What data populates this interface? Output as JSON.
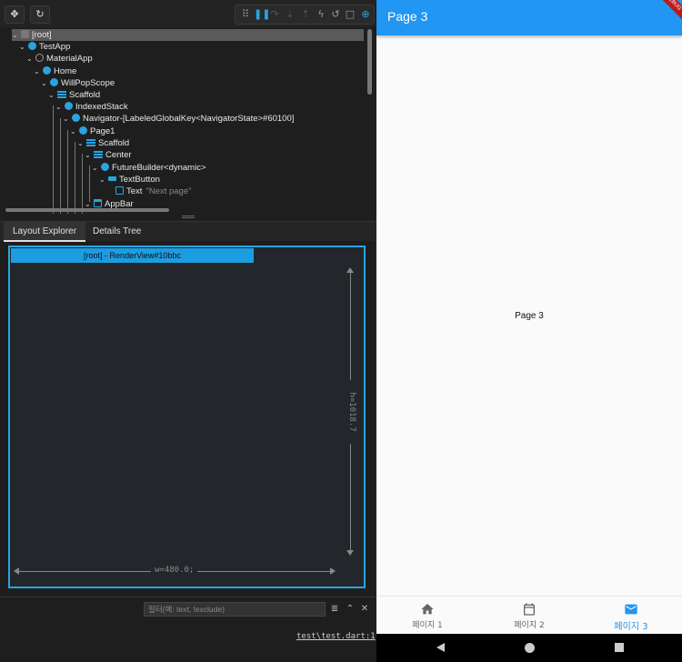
{
  "devtools": {
    "toolbar": {
      "select_widget_icon": "select-widget-icon",
      "refresh_icon": "refresh-icon",
      "group_icons": [
        "drag-handle-icon",
        "pause-icon",
        "redo-icon",
        "step-down-icon",
        "step-up-icon",
        "lightning-icon",
        "undo-icon",
        "square-icon",
        "zoom-icon"
      ]
    },
    "tree": {
      "nodes": [
        {
          "label": "[root]",
          "selected": true
        },
        {
          "label": "TestApp"
        },
        {
          "label": "MaterialApp"
        },
        {
          "label": "Home"
        },
        {
          "label": "WillPopScope"
        },
        {
          "label": "Scaffold"
        },
        {
          "label": "IndexedStack"
        },
        {
          "label": "Navigator-[LabeledGlobalKey<NavigatorState>#60100]"
        },
        {
          "label": "Page1"
        },
        {
          "label": "Scaffold"
        },
        {
          "label": "Center"
        },
        {
          "label": "FutureBuilder<dynamic>"
        },
        {
          "label": "TextButton"
        },
        {
          "label": "Text",
          "value": "\"Next page\""
        },
        {
          "label": "AppBar"
        }
      ]
    },
    "tabs": [
      {
        "label": "Layout Explorer",
        "active": true
      },
      {
        "label": "Details Tree",
        "active": false
      }
    ],
    "layout_explorer": {
      "node_label": "[root] - RenderView#10bbc",
      "height_label": "h=1018.7",
      "width_label": "w=480.0;"
    },
    "filter": {
      "placeholder": "필터(예: text, !exclude)"
    },
    "link": "test\\test.dart:1"
  },
  "app": {
    "title": "Page 3",
    "debug_banner": "DEBUG",
    "body_text": "Page 3",
    "nav": [
      {
        "label": "페이지 1",
        "icon": "home-icon",
        "active": false
      },
      {
        "label": "페이지 2",
        "icon": "calendar-icon",
        "active": false
      },
      {
        "label": "페이지 3",
        "icon": "mail-icon",
        "active": true
      }
    ],
    "accent_color": "#2196f3"
  }
}
